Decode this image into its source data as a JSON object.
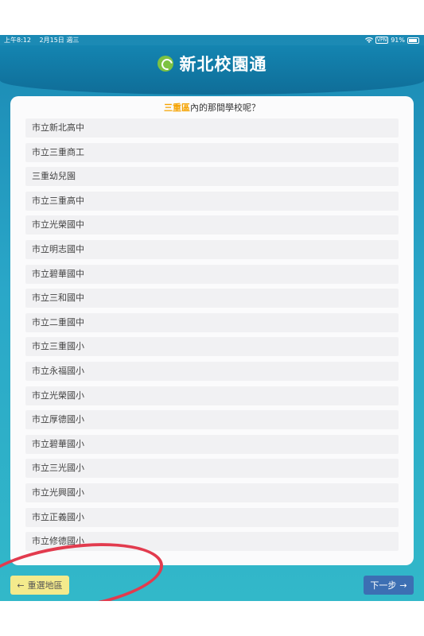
{
  "status_bar": {
    "time": "上午8:12",
    "date": "2月15日 週三",
    "vpn": "VPN",
    "battery": "91%"
  },
  "header": {
    "title": "新北校園通"
  },
  "question": {
    "area": "三重區",
    "text": "內的那間學校呢？"
  },
  "schools": [
    "市立新北高中",
    "市立三重商工",
    "三重幼兒園",
    "市立三重高中",
    "市立光榮國中",
    "市立明志國中",
    "市立碧華國中",
    "市立三和國中",
    "市立二重國中",
    "市立三重國小",
    "市立永福國小",
    "市立光榮國小",
    "市立厚德國小",
    "市立碧華國小",
    "市立三光國小",
    "市立光興國小",
    "市立正義國小",
    "市立修德國小"
  ],
  "buttons": {
    "back_arrow": "←",
    "back_label": "重選地區",
    "next_label": "下一步",
    "next_arrow": "→"
  },
  "colors": {
    "header": "#1485b1",
    "accent_area": "#f5a300",
    "annotation_ring": "#e23b4e",
    "back_button": "#f4ea8c",
    "next_button": "#3c6fb3"
  }
}
